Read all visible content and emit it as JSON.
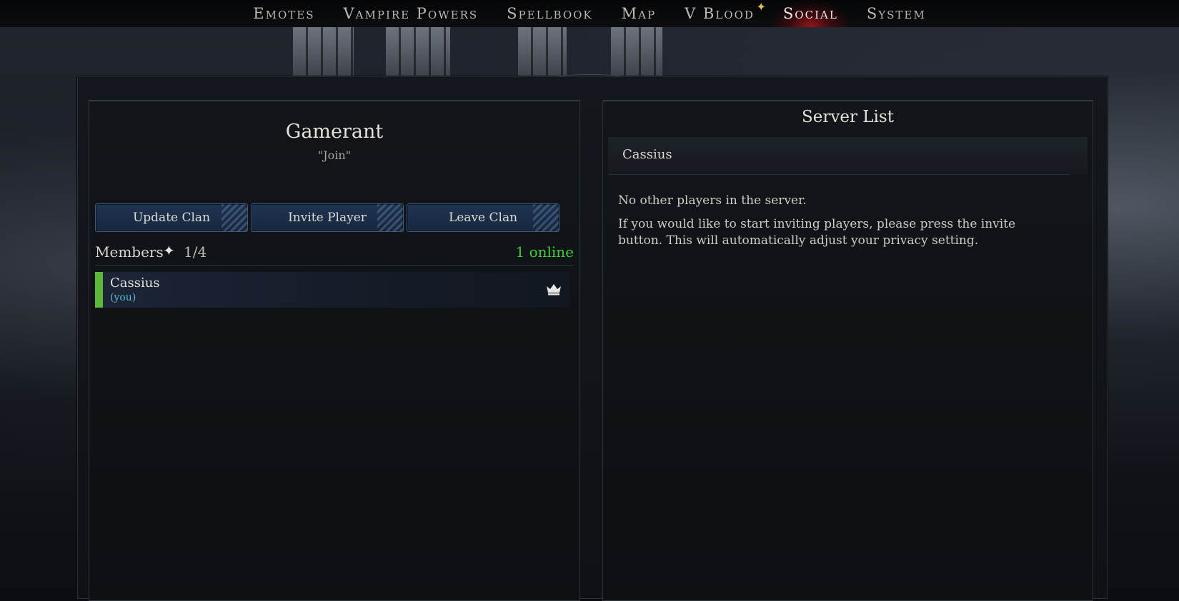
{
  "nav": {
    "items": [
      "Emotes",
      "Vampire Powers",
      "Spellbook",
      "Map",
      "V Blood",
      "Social",
      "System"
    ],
    "active": "Social"
  },
  "clan": {
    "name": "Gamerant",
    "motto": "\"Join\"",
    "buttons": {
      "update": "Update Clan",
      "invite": "Invite Player",
      "leave": "Leave Clan"
    },
    "members_label": "Members",
    "members_count": "1/4",
    "online": "1 online",
    "members": [
      {
        "name": "Cassius",
        "tag": "(you)",
        "status_color": "#5bb838",
        "icon": "crown-icon"
      }
    ]
  },
  "server": {
    "title": "Server List",
    "entry": "Cassius",
    "message1": "No other players in the server.",
    "message2": "If you would like to start inviting players, please press the invite button. This will automatically adjust your privacy setting."
  },
  "colors": {
    "online": "#3fcf3a",
    "active_tab": "#b4141e",
    "button": "#1f3452"
  }
}
